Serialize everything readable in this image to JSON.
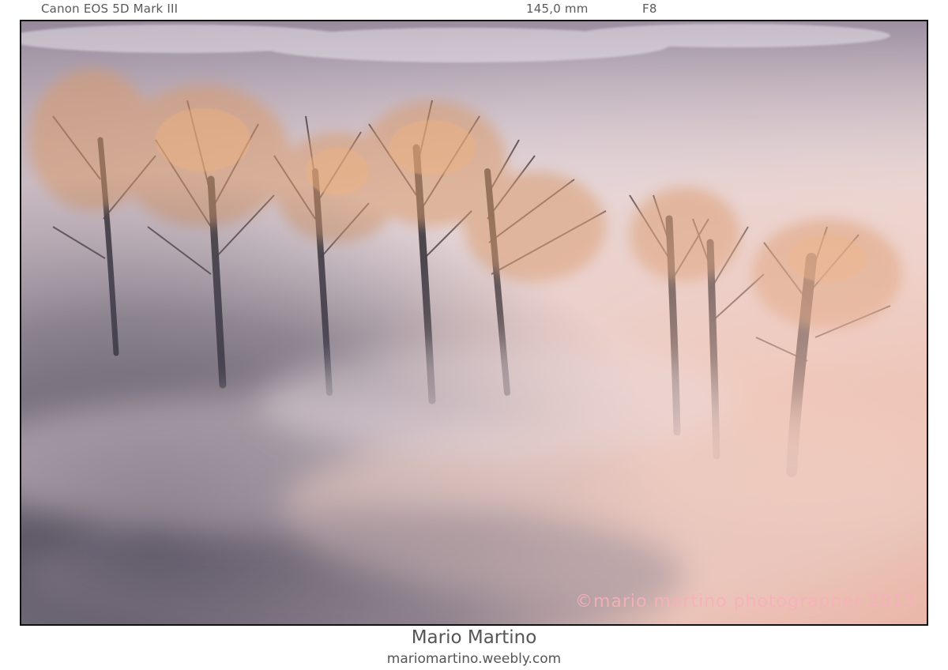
{
  "exif": {
    "camera": "Canon EOS 5D Mark III",
    "focal_length": "145,0 mm",
    "aperture": "F8"
  },
  "photo": {
    "watermark": "©mario martino photographer 2013",
    "subject": "bare-trees-in-morning-fog",
    "colors": {
      "fog_light": "#eedcdc",
      "fog_pink": "#e9b9ae",
      "fog_dark": "#3d3b4d",
      "branch_lit": "#d38a5c",
      "trunk": "#2e2b32"
    }
  },
  "caption": {
    "author": "Mario Martino",
    "website": "mariomartino.weebly.com"
  }
}
